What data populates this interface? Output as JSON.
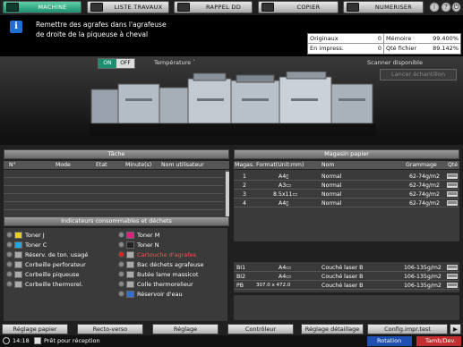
{
  "tabs": [
    {
      "label": "MACHINE",
      "active": true
    },
    {
      "label": "LISTE TRAVAUX",
      "active": false
    },
    {
      "label": "RAPPEL DD",
      "active": false
    },
    {
      "label": "COPIER",
      "active": false
    },
    {
      "label": "NUMERISER",
      "active": false
    }
  ],
  "top_icons": {
    "info": "i",
    "help": "?",
    "power": "⏻"
  },
  "message": {
    "line1": "Remettre des agrafes dans l'agrafeuse",
    "line2": "de droite de la piqueuse à cheval",
    "icon": "i"
  },
  "counters": {
    "originaux_label": "Originaux",
    "originaux_value": "0",
    "memoire_label": "Mémoire",
    "memoire_value": "99.400%",
    "en_impress_label": "En impress.",
    "en_impress_value": "0",
    "qte_fichier_label": "Qté fichier",
    "qte_fichier_value": "89.142%"
  },
  "machine": {
    "on_label": "ON",
    "off_label": "OFF",
    "temperature_label": "Température `",
    "scanner_label": "Scanner disponible",
    "lancer_label": "Lancer échantillon"
  },
  "tache": {
    "title": "Tâche",
    "columns": [
      "N°",
      "Mode",
      "Etat",
      "Minute(s)",
      "Nom utilisateur"
    ]
  },
  "magasin": {
    "title": "Magasin papier",
    "columns": [
      "Magas.",
      "Format(Unit:mm)",
      "Nom",
      "Grammage",
      "Qté"
    ],
    "rows": [
      {
        "magas": "1",
        "format": "A4▯",
        "nom": "Normal",
        "grammage": "62-74g/m2"
      },
      {
        "magas": "2",
        "format": "A3▭",
        "nom": "Normal",
        "grammage": "62-74g/m2"
      },
      {
        "magas": "3",
        "format": "8.5x11▭",
        "nom": "Normal",
        "grammage": "62-74g/m2"
      },
      {
        "magas": "4",
        "format": "A4▯",
        "nom": "Normal",
        "grammage": "62-74g/m2"
      },
      {
        "magas": "BI1",
        "format": "A4▭",
        "nom": "Couché laser B",
        "grammage": "106-135g/m2"
      },
      {
        "magas": "BI2",
        "format": "A4▭",
        "nom": "Couché laser B",
        "grammage": "106-135g/m2"
      },
      {
        "magas": "PB",
        "format": "307.0 x 472.0",
        "nom": "Couché laser B",
        "grammage": "106-135g/m2"
      }
    ]
  },
  "consumables": {
    "title": "Indicateurs consommables et déchets",
    "left": [
      {
        "label": "Toner J",
        "icon": "toner-icon",
        "status": "normal"
      },
      {
        "label": "Toner C",
        "icon": "toner-icon",
        "status": "normal"
      },
      {
        "label": "Réserv. de ton. usagé",
        "icon": "waste-toner-icon",
        "status": "normal"
      },
      {
        "label": "Corbeille perforateur",
        "icon": "punch-bin-icon",
        "status": "normal"
      },
      {
        "label": "Corbeille piqueuse",
        "icon": "staple-bin-icon",
        "status": "normal"
      },
      {
        "label": "Corbeille thermorel.",
        "icon": "binding-bin-icon",
        "status": "normal"
      }
    ],
    "right": [
      {
        "label": "Toner M",
        "icon": "toner-icon",
        "status": "normal"
      },
      {
        "label": "Toner N",
        "icon": "toner-icon",
        "status": "normal"
      },
      {
        "label": "Cartouche d'agrafes",
        "icon": "staple-cartridge-icon",
        "status": "error"
      },
      {
        "label": "Bac déchets agrafeuse",
        "icon": "staple-waste-icon",
        "status": "normal"
      },
      {
        "label": "Butée lame massicot",
        "icon": "trimmer-icon",
        "status": "normal"
      },
      {
        "label": "Colle thermorelieur",
        "icon": "glue-icon",
        "status": "normal"
      },
      {
        "label": "Réservoir d'eau",
        "icon": "water-tank-icon",
        "status": "normal"
      }
    ]
  },
  "bottom_buttons": [
    "Réglage papier",
    "Recto-verso",
    "Réglage",
    "Contrôleur",
    "Réglage détaillage",
    "Config.impr.test"
  ],
  "status": {
    "time": "14:18",
    "ready_text": "Prêt pour réception",
    "rotation_label": "Rotation",
    "tamb_label": "Tamb/Dev."
  },
  "colors": {
    "accent": "#1d8f70",
    "info": "#1f6fd0",
    "error": "#e02020"
  }
}
